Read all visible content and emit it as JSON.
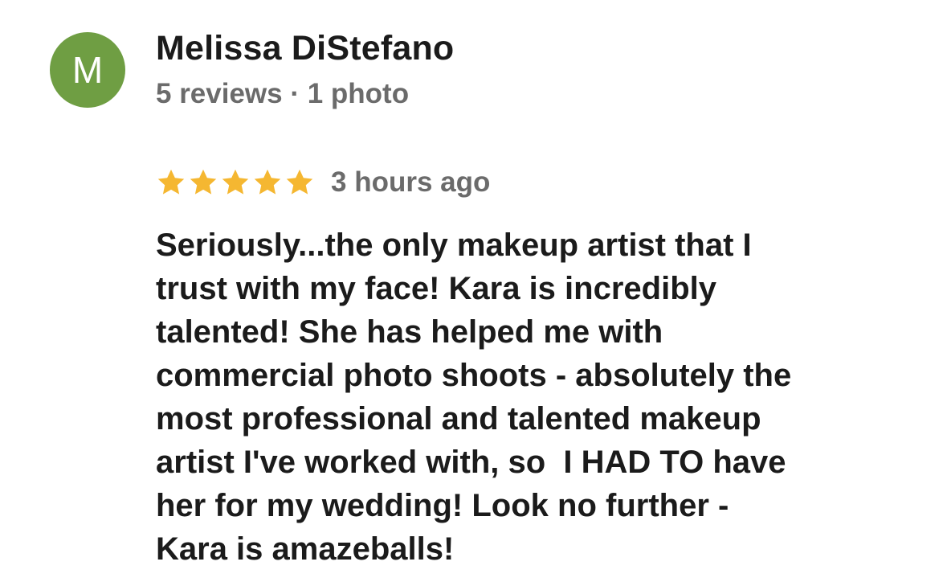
{
  "reviewer": {
    "avatar_letter": "M",
    "avatar_color": "#6f9e43",
    "name": "Melissa DiStefano",
    "meta": "5 reviews · 1 photo"
  },
  "rating": {
    "stars": 5,
    "max_stars": 5,
    "star_icon": "star-icon",
    "star_color": "#f5b731",
    "time": "3 hours ago"
  },
  "review": {
    "lines": [
      "Seriously...the only makeup artist that I",
      "trust with my face! Kara is incredibly",
      "talented! She has helped me with",
      "commercial photo shoots - absolutely the",
      "most professional and talented makeup",
      "artist I've worked with, so  I HAD TO have",
      "her for my wedding! Look no further -",
      "Kara is amazeballs!"
    ]
  }
}
